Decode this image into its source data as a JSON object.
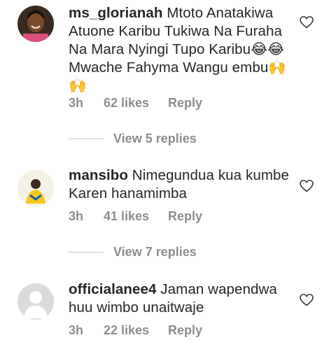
{
  "comments": [
    {
      "username": "ms_glorianah",
      "text": "Mtoto Anatakiwa Atuone Karibu Tukiwa Na Furaha Na Mara Nyingi Tupo Karibu😂😂 Mwache Fahyma Wangu embu🙌🙌",
      "time": "3h",
      "likes": "62 likes",
      "reply": "Reply",
      "view_replies": "View 5 replies"
    },
    {
      "username": "mansibo",
      "text": "Nimegundua kua kumbe Karen hanamimba",
      "time": "3h",
      "likes": "41 likes",
      "reply": "Reply",
      "view_replies": "View 7 replies"
    },
    {
      "username": "officialanee4",
      "text": "Jaman wapendwa huu wimbo unaitwaje",
      "time": "3h",
      "likes": "22 likes",
      "reply": "Reply"
    }
  ],
  "colors": {
    "text": "#262626",
    "muted": "#8e8e8e",
    "divider": "#c7c7c7"
  }
}
